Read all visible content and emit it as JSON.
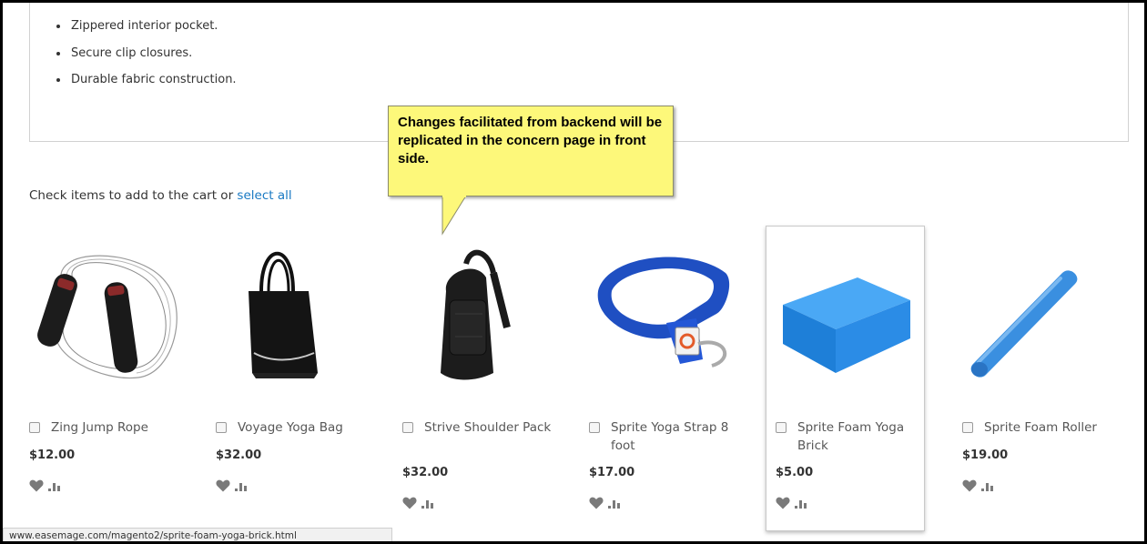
{
  "features": [
    "Zippered interior pocket.",
    "Secure clip closures.",
    "Durable fabric construction."
  ],
  "related": {
    "intro_text": "Check items to add to the cart or ",
    "select_all_label": "select all"
  },
  "callout": {
    "text": "Changes facilitated from backend will be replicated in the concern page in front side."
  },
  "products": [
    {
      "name": "Zing Jump Rope",
      "price": "$12.00"
    },
    {
      "name": "Voyage Yoga Bag",
      "price": "$32.00"
    },
    {
      "name": "Strive Shoulder Pack",
      "price": "$32.00"
    },
    {
      "name": "Sprite Yoga Strap 8 foot",
      "price": "$17.00"
    },
    {
      "name": "Sprite Foam Yoga Brick",
      "price": "$5.00"
    },
    {
      "name": "Sprite Foam Roller",
      "price": "$19.00"
    }
  ],
  "status_bar": {
    "url": "www.easemage.com/magento2/sprite-foam-yoga-brick.html"
  },
  "colors": {
    "link": "#1979c3",
    "callout_bg": "#fdf87a",
    "icon": "#7a7a7a"
  },
  "icons": [
    "heart-icon",
    "compare-icon"
  ]
}
